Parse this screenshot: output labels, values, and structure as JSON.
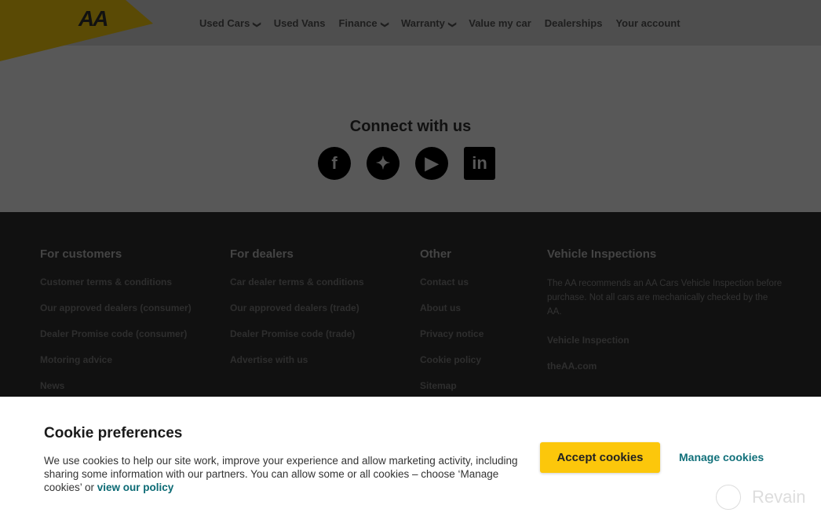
{
  "header": {
    "logo": "AA",
    "nav": [
      {
        "label": "Used Cars",
        "dropdown": true
      },
      {
        "label": "Used Vans",
        "dropdown": false
      },
      {
        "label": "Finance",
        "dropdown": true
      },
      {
        "label": "Warranty",
        "dropdown": true
      },
      {
        "label": "Value my car",
        "dropdown": false
      },
      {
        "label": "Dealerships",
        "dropdown": false
      },
      {
        "label": "Your account",
        "dropdown": false
      }
    ]
  },
  "connect": {
    "title": "Connect with us",
    "icons": [
      "facebook-icon",
      "twitter-icon",
      "youtube-icon",
      "linkedin-icon"
    ]
  },
  "footer": {
    "customers": {
      "title": "For customers",
      "links": [
        "Customer terms & conditions",
        "Our approved dealers (consumer)",
        "Dealer Promise code (consumer)",
        "Motoring advice",
        "News"
      ]
    },
    "dealers": {
      "title": "For dealers",
      "links": [
        "Car dealer terms & conditions",
        "Our approved dealers (trade)",
        "Dealer Promise code (trade)",
        "Advertise with us"
      ]
    },
    "other": {
      "title": "Other",
      "links": [
        "Contact us",
        "About us",
        "Privacy notice",
        "Cookie policy",
        "Sitemap"
      ]
    },
    "inspections": {
      "title": "Vehicle Inspections",
      "text": "The AA recommends an AA Cars Vehicle Inspection before purchase. Not all cars are mechanically checked by the AA.",
      "links": [
        "Vehicle Inspection",
        "theAA.com"
      ]
    }
  },
  "cookie": {
    "title": "Cookie preferences",
    "text": "We use cookies to help our site work, improve your experience and allow marketing activity, including sharing some information with our partners. You can allow some or all cookies – choose ‘Manage cookies’ or ",
    "policy_link": "view our policy",
    "accept": "Accept cookies",
    "manage": "Manage cookies"
  },
  "watermark": "Revain",
  "colors": {
    "brand_yellow": "#fcc70b",
    "link_teal": "#11707a"
  }
}
